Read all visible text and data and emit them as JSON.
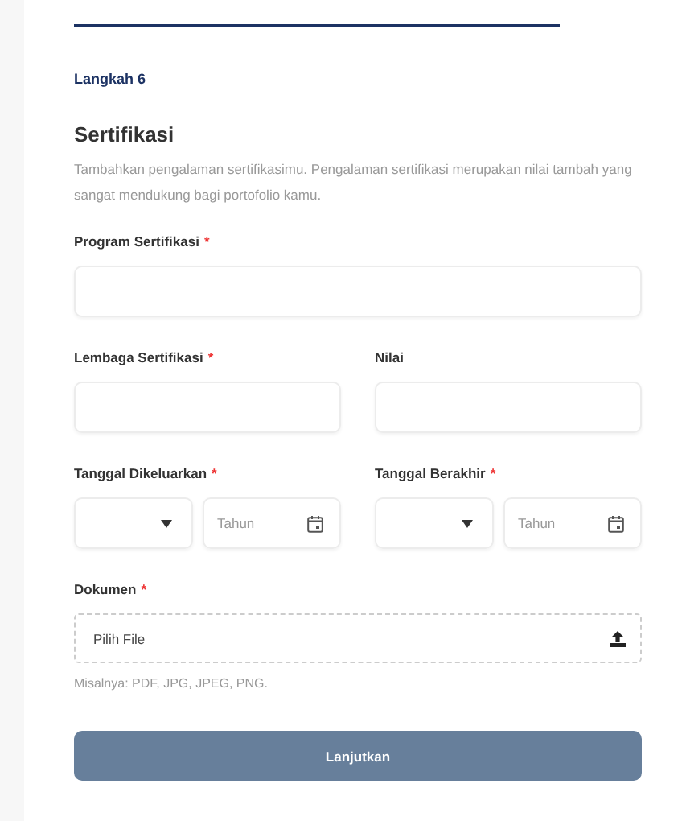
{
  "step": "Langkah 6",
  "title": "Sertifikasi",
  "description": "Tambahkan pengalaman sertifikasimu. Pengalaman sertifikasi merupakan nilai tambah yang sangat mendukung bagi portofolio kamu.",
  "rows": [
    [
      {
        "kind": "text",
        "label": "Program Sertifikasi",
        "required_mark": "*"
      }
    ],
    [
      {
        "kind": "text",
        "label": "Lembaga Sertifikasi",
        "required_mark": "*"
      },
      {
        "kind": "text",
        "label": "Nilai"
      }
    ],
    [
      {
        "kind": "date",
        "label": "Tanggal Dikeluarkan",
        "required_mark": "*",
        "year_placeholder": "Tahun"
      },
      {
        "kind": "date",
        "label": "Tanggal Berakhir",
        "required_mark": "*",
        "year_placeholder": "Tahun"
      }
    ],
    [
      {
        "kind": "file",
        "label": "Dokumen",
        "required_mark": "*",
        "button": "Pilih File",
        "hint": "Misalnya: PDF, JPG, JPEG, PNG."
      }
    ]
  ],
  "submit": {
    "label": "Lanjutkan",
    "disabled": true
  }
}
